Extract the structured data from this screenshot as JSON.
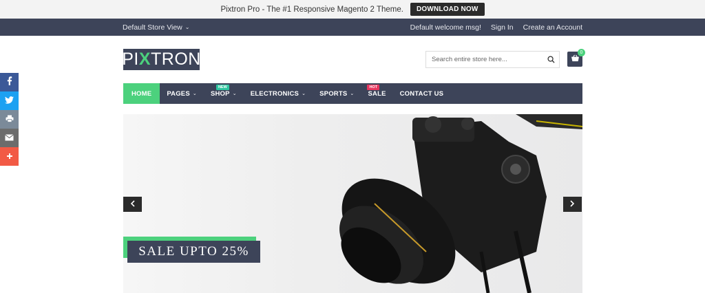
{
  "promo": {
    "text": "Pixtron Pro - The #1 Responsive Magento 2 Theme.",
    "button": "DOWNLOAD NOW"
  },
  "topbar": {
    "store_view": "Default Store View",
    "welcome": "Default welcome msg!",
    "sign_in": "Sign In",
    "create_account": "Create an Account"
  },
  "header": {
    "logo_left": "PI",
    "logo_x": "X",
    "logo_right": "TRON",
    "search_placeholder": "Search entire store here...",
    "cart_count": "0"
  },
  "nav": {
    "items": [
      {
        "label": "HOME",
        "active": true
      },
      {
        "label": "PAGES",
        "dropdown": true
      },
      {
        "label": "SHOP",
        "dropdown": true,
        "badge": "NEW"
      },
      {
        "label": "ELECTRONICS",
        "dropdown": true
      },
      {
        "label": "SPORTS",
        "dropdown": true
      },
      {
        "label": "SALE",
        "badge": "HOT"
      },
      {
        "label": "CONTACT US"
      }
    ]
  },
  "banner": {
    "sale_text": "SALE UPTO 25%",
    "prev_icon": "chevron-left-icon",
    "next_icon": "chevron-right-icon"
  },
  "social": [
    "facebook-icon",
    "twitter-icon",
    "print-icon",
    "email-icon",
    "share-plus-icon"
  ],
  "colors": {
    "brand_dark": "#3d4459",
    "accent_green": "#4cd17d",
    "hot_pink": "#e8375f",
    "facebook": "#3b5998",
    "twitter": "#1da1f2",
    "share": "#f25a45"
  }
}
